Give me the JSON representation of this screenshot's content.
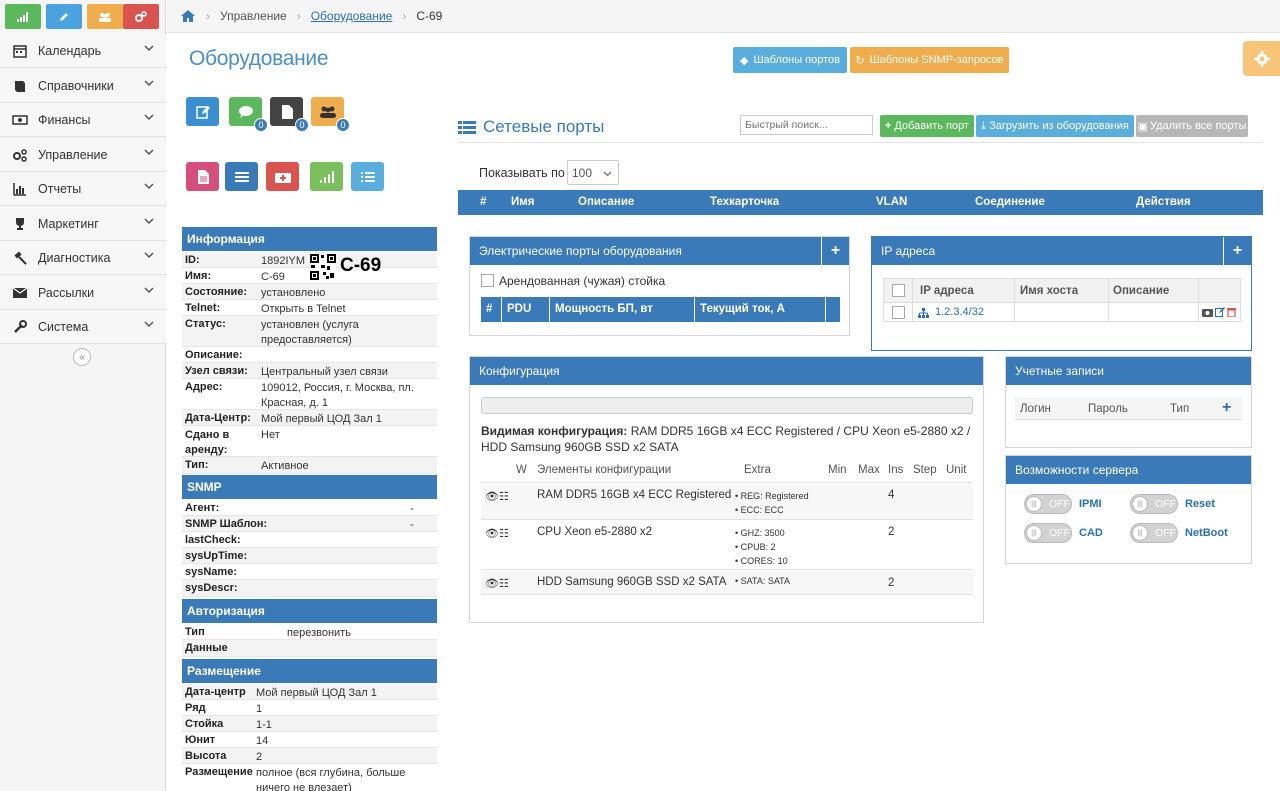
{
  "breadcrumb": {
    "item1": "Управление",
    "item2": "Оборудование",
    "item3": "С-69"
  },
  "sidebar": {
    "items": [
      {
        "label": "Календарь"
      },
      {
        "label": "Справочники"
      },
      {
        "label": "Финансы"
      },
      {
        "label": "Управление"
      },
      {
        "label": "Отчеты"
      },
      {
        "label": "Маркетинг"
      },
      {
        "label": "Диагностика"
      },
      {
        "label": "Рассылки"
      },
      {
        "label": "Система"
      }
    ],
    "collapse": "«"
  },
  "page": {
    "title": "Оборудование"
  },
  "header_buttons": {
    "port_templates": "Шаблоны портов",
    "snmp_templates": "Шаблоны SNMP-запросов"
  },
  "action_badges": {
    "comments": "0",
    "docs": "0",
    "clients": "0"
  },
  "info": {
    "title": "Информация",
    "id_label": "ID:",
    "id_value": "1892IYM",
    "qr_label": "С-69",
    "name_label": "Имя:",
    "name_value": "С-69",
    "state_label": "Состояние:",
    "state_value": "установлено",
    "telnet_label": "Telnet:",
    "telnet_value": "Открыть в Telnet",
    "status_label": "Статус:",
    "status_value": "установлен (услуга предоставляется)",
    "desc_label": "Описание:",
    "node_label": "Узел связи:",
    "node_value": "Центральный узел связи",
    "address_label": "Адрес:",
    "address_value": "109012, Россия, г. Москва, пл. Красная, д. 1",
    "dc_label": "Дата-Центр:",
    "dc_value": "Мой первый ЦОД Зал 1",
    "rent_label": "Сдано в аренду:",
    "rent_value": "Нет",
    "type_label": "Тип:",
    "type_value": "Активное"
  },
  "snmp": {
    "title": "SNMP",
    "agent_label": "Агент:",
    "agent_value": "-",
    "template_label": "SNMP Шаблон:",
    "template_value": "-",
    "lastcheck_label": "lastCheck:",
    "uptime_label": "sysUpTime:",
    "sysname_label": "sysName:",
    "sysdescr_label": "sysDescr:"
  },
  "auth": {
    "title": "Авторизация",
    "type_label": "Тип",
    "type_value": "перезвонить",
    "data_label": "Данные"
  },
  "placement": {
    "title": "Размещение",
    "dc_label": "Дата-центр",
    "dc_value": "Мой первый ЦОД Зал 1",
    "row_label": "Ряд",
    "row_value": "1",
    "rack_label": "Стойка",
    "rack_value": "1-1",
    "unit_label": "Юнит",
    "unit_value": "14",
    "height_label": "Высота",
    "height_value": "2",
    "place_label": "Размещение",
    "place_value": "полное (вся глубина, больше ничего не влезает)"
  },
  "ports": {
    "title": "Сетевые порты",
    "search_placeholder": "Быстрый поиск...",
    "add_btn": "Добавить порт",
    "load_btn": "Загрузить из оборудования",
    "delete_btn": "Удалить все порты",
    "show_label": "Показывать по",
    "show_value": "100",
    "columns": [
      "#",
      "Имя",
      "Описание",
      "Техкарточка",
      "VLAN",
      "Соединение",
      "Действия"
    ]
  },
  "electric": {
    "title": "Электрические порты оборудования",
    "rented_label": "Арендованная (чужая) стойка",
    "columns": [
      "#",
      "PDU",
      "Мощность БП, вт",
      "Текущий ток, А"
    ]
  },
  "ip": {
    "title": "IP адреса",
    "columns": [
      "IP адреса",
      "Имя хоста",
      "Описание"
    ],
    "rows": [
      {
        "ip": "1.2.3.4/32"
      }
    ]
  },
  "config": {
    "title": "Конфигурация",
    "visible_label": "Видимая конфигурация:",
    "visible_value": "RAM DDR5 16GB x4 ECC Registered / CPU Xeon e5-2880 x2 / HDD Samsung 960GB SSD x2 SATA",
    "columns": [
      "W",
      "Элементы конфигурации",
      "Extra",
      "Min",
      "Max",
      "Ins",
      "Step",
      "Unit"
    ],
    "rows": [
      {
        "name": "RAM DDR5 16GB x4 ECC Registered",
        "extra1": "• REG: Registered",
        "extra2": "• ECC: ECC",
        "extra3": "",
        "ins": "4"
      },
      {
        "name": "CPU Xeon e5-2880 x2",
        "extra1": "• GHZ: 3500",
        "extra2": "• CPUB: 2",
        "extra3": "• CORES: 10",
        "ins": "2"
      },
      {
        "name": "HDD Samsung 960GB SSD x2 SATA",
        "extra1": "• SATA: SATA",
        "extra2": "",
        "extra3": "",
        "ins": "2"
      }
    ]
  },
  "accounts": {
    "title": "Учетные записи",
    "columns": [
      "Логин",
      "Пароль",
      "Тип"
    ]
  },
  "server": {
    "title": "Возможности сервера",
    "toggles": [
      {
        "state": "OFF",
        "label": "IPMI"
      },
      {
        "state": "OFF",
        "label": "Reset"
      },
      {
        "state": "OFF",
        "label": "CAD"
      },
      {
        "state": "OFF",
        "label": "NetBoot"
      }
    ]
  }
}
